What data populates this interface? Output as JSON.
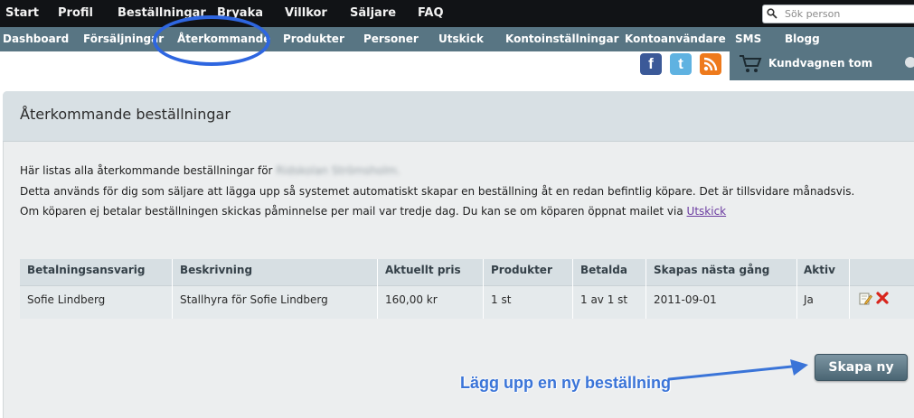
{
  "topnav": {
    "items": [
      "Start",
      "Profil",
      "Beställningar",
      "Bryaka",
      "Villkor",
      "Säljare",
      "FAQ"
    ],
    "search_placeholder": "Sök person"
  },
  "subnav": {
    "items": [
      "Dashboard",
      "Försäljningar",
      "Återkommande",
      "Produkter",
      "Personer",
      "Utskick",
      "Kontoinställningar",
      "Kontoanvändare",
      "SMS",
      "Blogg"
    ],
    "active": "Återkommande"
  },
  "social": {
    "facebook": "f",
    "twitter": "t",
    "rss": "rss"
  },
  "cart": {
    "label": "Kundvagnen tom"
  },
  "panel": {
    "title": "Återkommande beställningar",
    "intro_1": "Här listas alla återkommande beställningar för",
    "blurred_name": "Ridskolan Strömsholm.",
    "intro_2": "Detta används för dig som säljare att lägga upp så systemet automatiskt skapar en beställning åt en redan befintlig köpare. Det är tillsvidare månadsvis.",
    "intro_3": "Om köparen ej betalar beställningen skickas påminnelse per mail var tredje dag. Du kan se om köparen öppnat mailet via",
    "link": "Utskick"
  },
  "table": {
    "headers": [
      "Betalningsansvarig",
      "Beskrivning",
      "Aktuellt pris",
      "Produkter",
      "Betalda",
      "Skapas nästa gång",
      "Aktiv"
    ],
    "rows": [
      [
        "Sofie Lindberg",
        "Stallhyra för Sofie Lindberg",
        "160,00 kr",
        "1 st",
        "1 av 1 st",
        "2011-09-01",
        "Ja"
      ]
    ],
    "icons": [
      "edit-icon",
      "delete-icon"
    ]
  },
  "actions": {
    "create_label": "Skapa ny"
  },
  "annotation": {
    "callout": "Lägg upp en ny beställning"
  },
  "colors": {
    "topbar": "#111316",
    "subbar": "#587583",
    "annotation": "#2e66e0",
    "delete": "#d8251c"
  }
}
